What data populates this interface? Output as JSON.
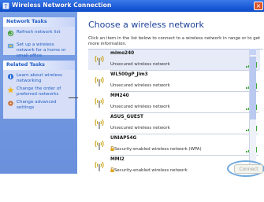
{
  "window": {
    "title": "Wireless Network Connection"
  },
  "left": {
    "network_tasks": {
      "header": "Network Tasks",
      "items": [
        {
          "label": "Refresh network list",
          "icon": "refresh-icon"
        },
        {
          "label": "Set up a wireless network for a home or small office",
          "icon": "setup-wizard-icon"
        }
      ]
    },
    "related_tasks": {
      "header": "Related Tasks",
      "items": [
        {
          "label": "Learn about wireless networking",
          "icon": "info-icon"
        },
        {
          "label": "Change the order of preferred networks",
          "icon": "star-icon"
        },
        {
          "label": "Change advanced settings",
          "icon": "settings-icon"
        }
      ]
    }
  },
  "main": {
    "title": "Choose a wireless network",
    "instructions": "Click an item in the list below to connect to a wireless network in range or to get more information.",
    "networks": [
      {
        "ssid": "mimo240",
        "status": "Unsecured wireless network",
        "secured": false
      },
      {
        "ssid": "WL500gP_Jim3",
        "status": "Unsecured wireless network",
        "secured": false
      },
      {
        "ssid": "MM240",
        "status": "Unsecured wireless network",
        "secured": false
      },
      {
        "ssid": "ASUS_GUEST",
        "status": "Unsecured wireless network",
        "secured": false
      },
      {
        "ssid": "UNIAP54G",
        "status": "Security-enabled wireless network (WPA)",
        "secured": true
      },
      {
        "ssid": "MMI2",
        "status": "Security-enabled wireless network",
        "secured": true
      }
    ],
    "connect_label": "Connect"
  },
  "colors": {
    "title_blue": "#1c5bd8",
    "link_blue": "#215dc6",
    "highlight": "#6fa9dd"
  }
}
